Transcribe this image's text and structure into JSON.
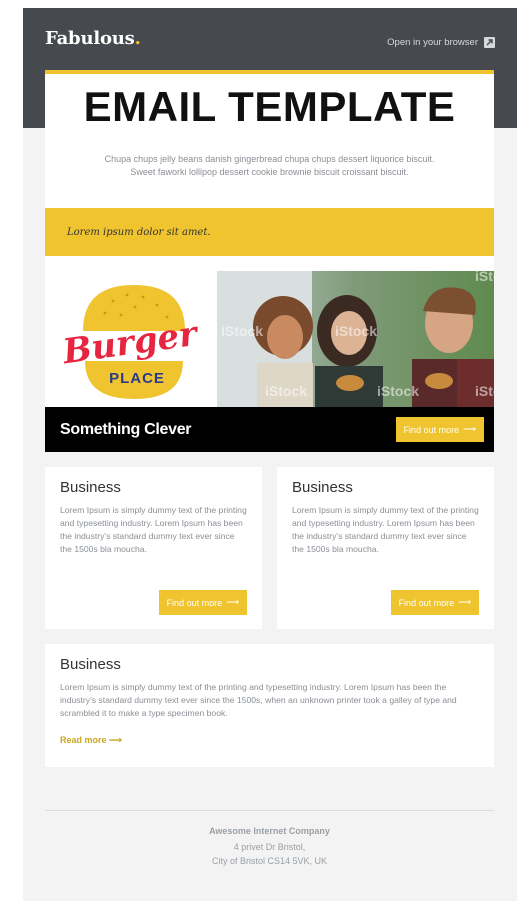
{
  "header": {
    "brand": "Fabulous",
    "brand_dot": ".",
    "open_browser": "Open in your browser",
    "open_browser_icon": "external-link-icon"
  },
  "hero": {
    "title": "EMAIL TEMPLATE",
    "text": "Chupa chups jelly beans danish gingerbread chupa chups dessert liquorice biscuit. Sweet faworki lollipop dessert cookie brownie biscuit croissant biscuit."
  },
  "highlight": {
    "text": "Lorem ipsum dolor sit amet."
  },
  "banner": {
    "logo_line1": "Burger",
    "logo_line2": "PLACE",
    "watermark": "iStock",
    "title": "Something Clever",
    "button": "Find out more",
    "arrow": "⟶"
  },
  "columns": [
    {
      "title": "Business",
      "text": "Lorem Ipsum is simply dummy text of the printing and typesetting industry. Lorem Ipsum has been the industry's standard dummy text ever since the 1500s bla moucha.",
      "button": "Find out more"
    },
    {
      "title": "Business",
      "text": "Lorem Ipsum is simply dummy text of the printing and typesetting industry. Lorem Ipsum has been the industry's standard dummy text ever since the 1500s bla moucha.",
      "button": "Find out more"
    }
  ],
  "wide": {
    "title": "Business",
    "text": "Lorem Ipsum is simply dummy text of the printing and typesetting industry. Lorem Ipsum has been the industry's standard dummy text ever since the 1500s, when an unknown printer took a galley of type and scrambled it to make a type specimen book.",
    "read_more": "Read more"
  },
  "footer": {
    "company": "Awesome Internet Company",
    "address_line1": "4 privet Dr Bristol,",
    "address_line2": "City of Bristol  CS14 5VK, UK"
  },
  "colors": {
    "accent": "#f0c42f",
    "dark": "#464a4e",
    "background": "#f3f3f3"
  }
}
